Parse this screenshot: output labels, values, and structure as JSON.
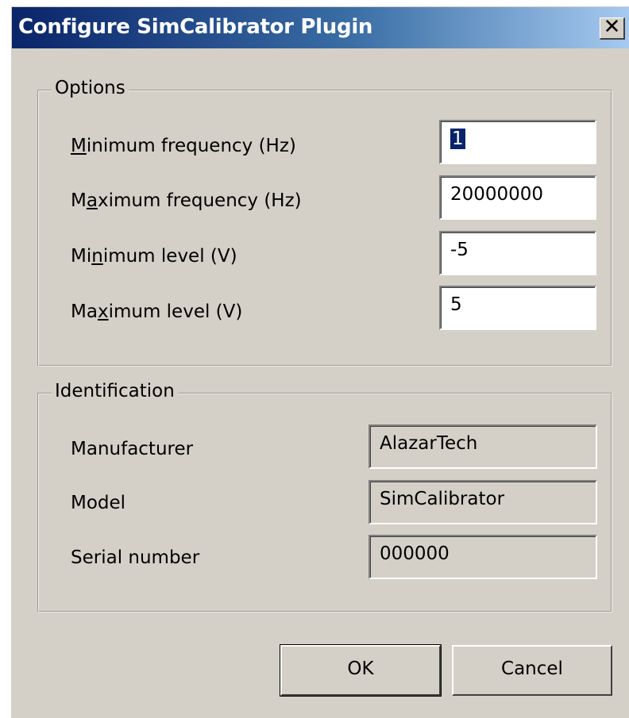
{
  "window": {
    "title": "Configure SimCalibrator Plugin",
    "close_label": "✕"
  },
  "options": {
    "legend": "Options",
    "min_freq": {
      "label_pre": "",
      "label_key": "M",
      "label_post": "inimum frequency (Hz)",
      "value": "1"
    },
    "max_freq": {
      "label_pre": "M",
      "label_key": "a",
      "label_post": "ximum frequency (Hz)",
      "value": "20000000"
    },
    "min_level": {
      "label_pre": "Mi",
      "label_key": "n",
      "label_post": "imum level (V)",
      "value": "-5"
    },
    "max_level": {
      "label_pre": "Ma",
      "label_key": "x",
      "label_post": "imum level (V)",
      "value": "5"
    }
  },
  "identification": {
    "legend": "Identification",
    "manufacturer": {
      "label": "Manufacturer",
      "value": "AlazarTech"
    },
    "model": {
      "label": "Model",
      "value": "SimCalibrator"
    },
    "serial": {
      "label": "Serial number",
      "value": "000000"
    }
  },
  "buttons": {
    "ok": "OK",
    "cancel": "Cancel"
  }
}
